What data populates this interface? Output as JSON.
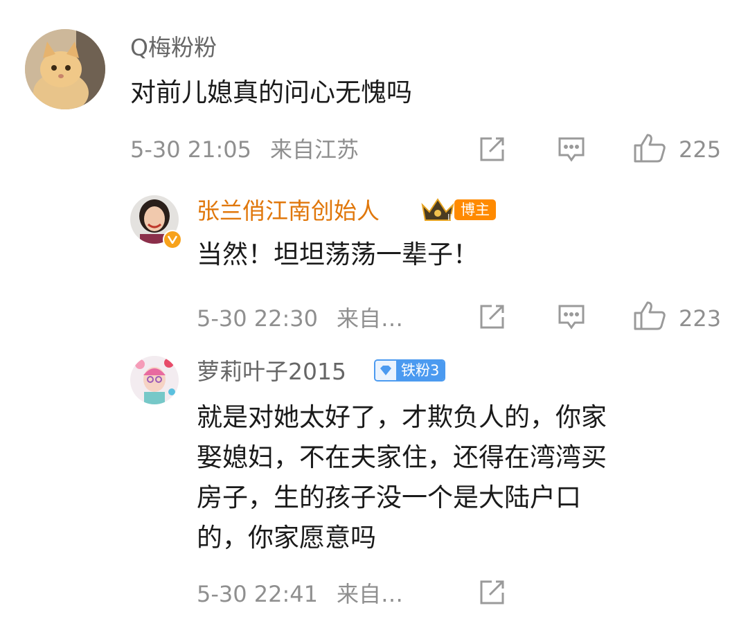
{
  "comments": [
    {
      "author": "Q梅粉粉",
      "text": "对前儿媳真的问心无愧吗",
      "time": "5-30 21:05",
      "location": "来自江苏",
      "likes": "225",
      "avatar_icon": "cat-avatar"
    },
    {
      "author": "张兰俏江南创始人",
      "badge": "博主",
      "text": "当然！坦坦荡荡一辈子！",
      "time": "5-30 22:30",
      "location": "来自…",
      "likes": "223",
      "avatar_icon": "woman-avatar",
      "verified_icon": "verified-v-icon"
    },
    {
      "author": "萝莉叶子2015",
      "badge": "铁粉3",
      "text_lines": [
        "就是对她太好了，才欺负人的，你家",
        "娶媳妇，不在夫家住，还得在湾湾买",
        "房子，生的孩子没一个是大陆户口",
        "的，你家愿意吗"
      ],
      "time": "5-30 22:41",
      "location": "来自…",
      "avatar_icon": "girl-avatar"
    }
  ],
  "colors": {
    "blogger_name": "#e0770b",
    "badge_blogger": "#ff8a00",
    "badge_fan": "#4b9af0",
    "meta_gray": "#8f8f8f"
  }
}
